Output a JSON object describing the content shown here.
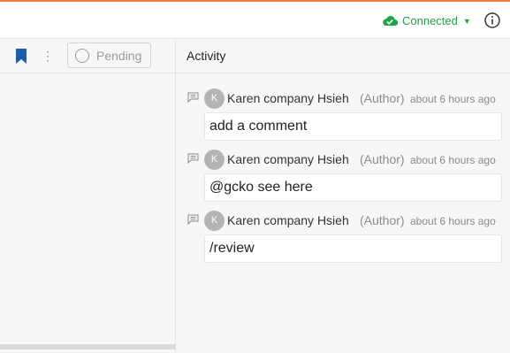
{
  "colors": {
    "accent_line": "#f07b3f",
    "connected_green": "#1ea446",
    "bookmark_blue": "#1d5fa8",
    "avatar_gray": "#b4b4b4"
  },
  "status": {
    "label": "Connected",
    "icon": "cloud-check-icon"
  },
  "toolbar": {
    "pending_label": "Pending"
  },
  "activity": {
    "title": "Activity",
    "entries": [
      {
        "avatar_initial": "K",
        "author": "Karen company Hsieh",
        "role": "(Author)",
        "time": "about 6 hours ago",
        "text": "add a comment"
      },
      {
        "avatar_initial": "K",
        "author": "Karen company Hsieh",
        "role": "(Author)",
        "time": "about 6 hours ago",
        "text": "@gcko see here"
      },
      {
        "avatar_initial": "K",
        "author": "Karen company Hsieh",
        "role": "(Author)",
        "time": "about 6 hours ago",
        "text": "/review"
      }
    ]
  }
}
